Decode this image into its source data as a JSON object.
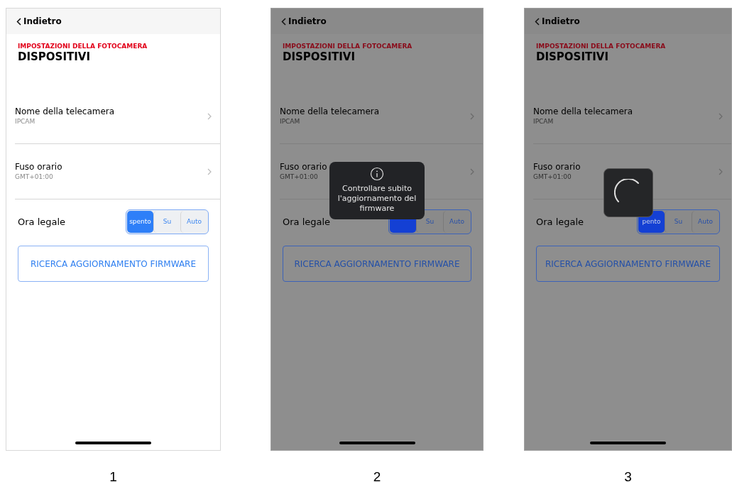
{
  "screens": [
    {
      "caption": "1",
      "dimmed": false,
      "back": "Indietro",
      "section": "IMPOSTAZIONI DELLA FOTOCAMERA",
      "title": "DISPOSITIVI",
      "rows": [
        {
          "label": "Nome della telecamera",
          "value": "IPCAM"
        },
        {
          "label": "Fuso orario",
          "value": "GMT+01:00"
        }
      ],
      "dst": {
        "label": "Ora legale",
        "segments": [
          {
            "label": "spento",
            "selected": true
          },
          {
            "label": "Su",
            "selected": false
          },
          {
            "label": "Auto",
            "selected": false
          }
        ]
      },
      "action": "RICERCA AGGIORNAMENTO FIRMWARE"
    },
    {
      "caption": "2",
      "dimmed": true,
      "back": "Indietro",
      "section": "IMPOSTAZIONI DELLA FOTOCAMERA",
      "title": "DISPOSITIVI",
      "rows": [
        {
          "label": "Nome della telecamera",
          "value": "IPCAM"
        },
        {
          "label": "Fuso orario",
          "value": "GMT+01:00"
        }
      ],
      "dst": {
        "label": "Ora legale",
        "segments": [
          {
            "selected": true
          },
          {
            "label": "Su",
            "selected": false
          },
          {
            "label": "Auto",
            "selected": false
          }
        ]
      },
      "action": "RICERCA AGGIORNAMENTO FIRMWARE",
      "overlay": {
        "kind": "toast",
        "message": "Controllare subito l'aggiornamento del firmware"
      }
    },
    {
      "caption": "3",
      "dimmed": true,
      "back": "Indietro",
      "section": "IMPOSTAZIONI DELLA FOTOCAMERA",
      "title": "DISPOSITIVI",
      "rows": [
        {
          "label": "Nome della telecamera",
          "value": "IPCAM"
        },
        {
          "label": "Fuso orario",
          "value": "GMT+01:00"
        }
      ],
      "dst": {
        "label": "Ora legale",
        "segments": [
          {
            "label": "pento",
            "selected": true
          },
          {
            "label": "Su",
            "selected": false
          },
          {
            "label": "Auto",
            "selected": false
          }
        ]
      },
      "action": "RICERCA AGGIORNAMENTO FIRMWARE",
      "overlay": {
        "kind": "spinner"
      }
    }
  ]
}
